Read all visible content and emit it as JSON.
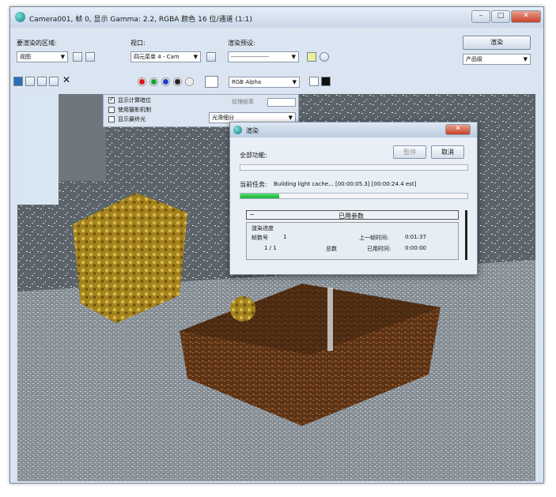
{
  "window": {
    "title": "Camera001, 帧 0, 显示 Gamma: 2.2, RGBA 颜色 16 位/通道 (1:1)",
    "minimize_glyph": "–",
    "maximize_glyph": "□",
    "close_glyph": "✕"
  },
  "toolbar": {
    "area_label": "要渲染的区域:",
    "area_value": "视图",
    "viewport_label": "视口:",
    "viewport_value": "四元菜单 4 - Cam",
    "preset_label": "渲染预设:",
    "preset_value": "-------------------",
    "render_button": "渲染",
    "mode_value": "产品级",
    "channel_value": "RGB Alpha",
    "clear_glyph": "✕"
  },
  "options": {
    "items": [
      "显示计算暗位",
      "使用摄影机制",
      "显示最终光"
    ],
    "checked": [
      true,
      false,
      false
    ],
    "frame_label": "纹理帧率",
    "frame_value": "",
    "subdivision_value": "光滑细分"
  },
  "render_dialog": {
    "title": "渲染",
    "overall_label": "全部功能:",
    "pause_button": "暂停",
    "cancel_button": "取消",
    "task_label": "当前任务:",
    "task_text": "Building light cache... [00:00:05.3] [00:00:24.4 est]",
    "task_progress": 0.17,
    "section_sign": "−",
    "section_title": "已用参数",
    "group_title": "渲染进度",
    "frame_no_label": "帧数号",
    "frame_no_value": "1",
    "frame_count": "1 / 1",
    "total_label": "总数",
    "last_frame_label": "上一帧时间:",
    "last_frame_value": "0:01:37",
    "elapsed_label": "已用时间:",
    "elapsed_value": "0:00:00"
  },
  "colors": {
    "red": "#e0141c",
    "green": "#17a33b",
    "blue": "#1b3fd0"
  }
}
